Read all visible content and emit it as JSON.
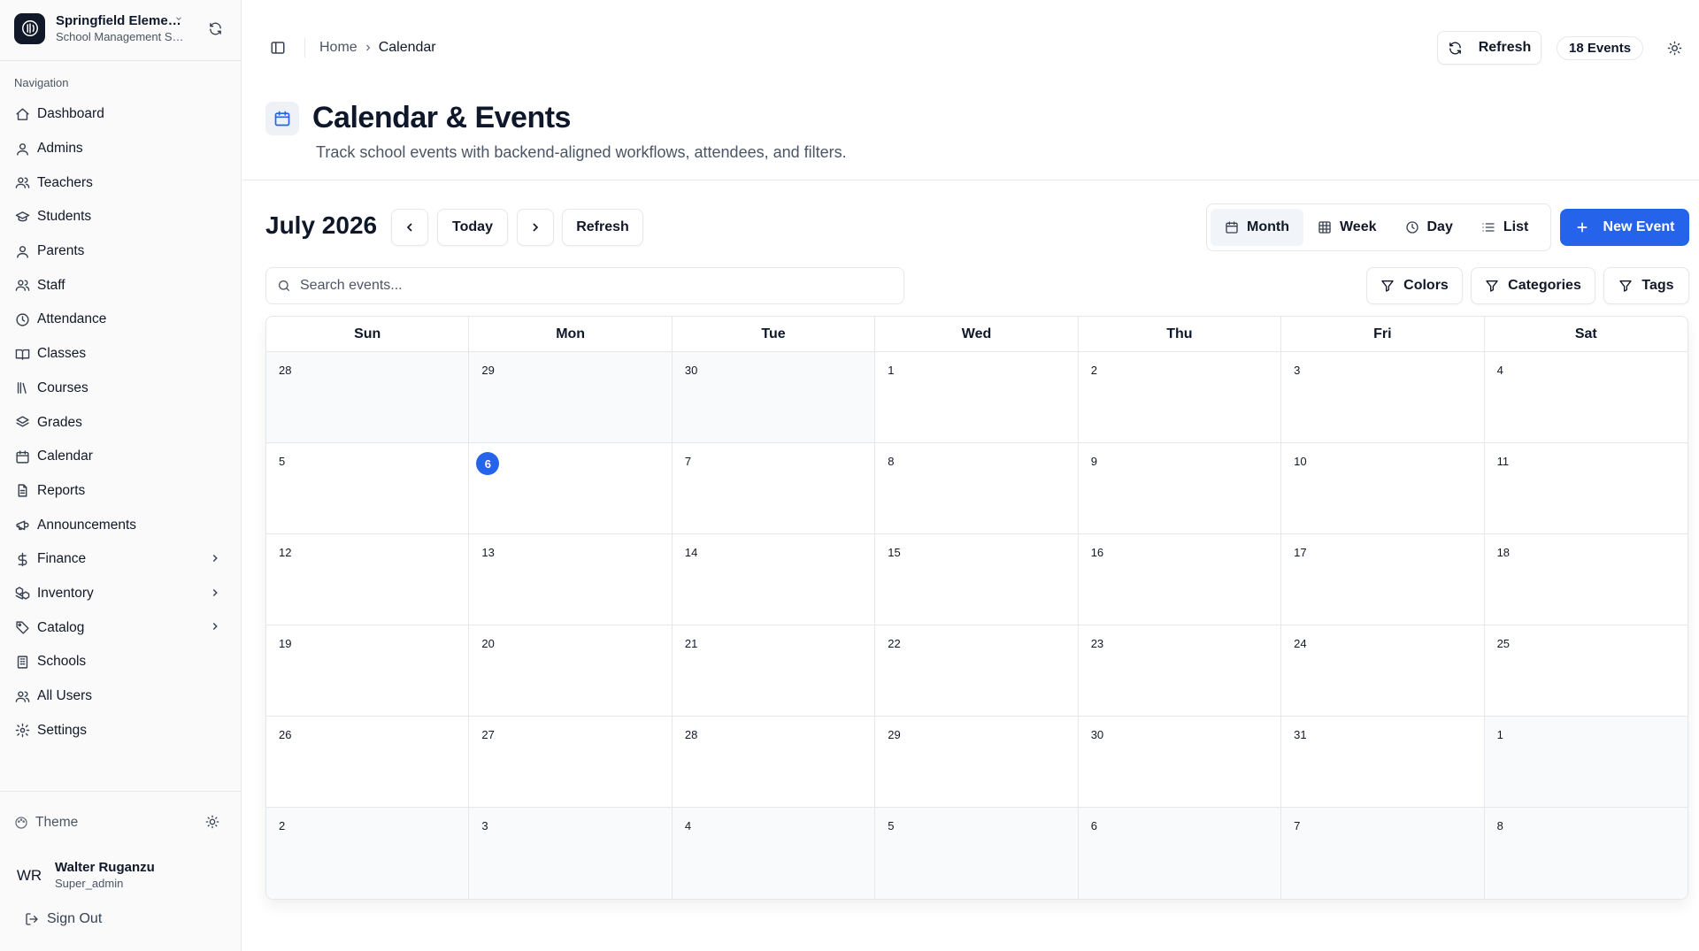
{
  "sidebar": {
    "org_name": "Springfield Elementary School",
    "org_subtitle": "School Management System",
    "nav_label": "Navigation",
    "items": [
      {
        "label": "Dashboard",
        "icon": "home-icon",
        "chevron": false
      },
      {
        "label": "Admins",
        "icon": "user-icon",
        "chevron": false
      },
      {
        "label": "Teachers",
        "icon": "users-icon",
        "chevron": false
      },
      {
        "label": "Students",
        "icon": "graduation-cap-icon",
        "chevron": false
      },
      {
        "label": "Parents",
        "icon": "user-icon",
        "chevron": false
      },
      {
        "label": "Staff",
        "icon": "users-icon",
        "chevron": false
      },
      {
        "label": "Attendance",
        "icon": "clock-icon",
        "chevron": false
      },
      {
        "label": "Classes",
        "icon": "book-open-icon",
        "chevron": false
      },
      {
        "label": "Courses",
        "icon": "library-icon",
        "chevron": false
      },
      {
        "label": "Grades",
        "icon": "layers-icon",
        "chevron": false
      },
      {
        "label": "Calendar",
        "icon": "calendar-icon",
        "chevron": false
      },
      {
        "label": "Reports",
        "icon": "file-text-icon",
        "chevron": false
      },
      {
        "label": "Announcements",
        "icon": "megaphone-icon",
        "chevron": false
      },
      {
        "label": "Finance",
        "icon": "dollar-icon",
        "chevron": true
      },
      {
        "label": "Inventory",
        "icon": "boxes-icon",
        "chevron": true
      },
      {
        "label": "Catalog",
        "icon": "tags-icon",
        "chevron": true
      },
      {
        "label": "Schools",
        "icon": "building-icon",
        "chevron": false
      },
      {
        "label": "All Users",
        "icon": "users-icon",
        "chevron": false
      },
      {
        "label": "Settings",
        "icon": "gear-icon",
        "chevron": false
      }
    ],
    "theme_label": "Theme",
    "user": {
      "initials": "WR",
      "name": "Walter Ruganzu",
      "role": "Super_admin"
    },
    "signout_label": "Sign Out"
  },
  "topbar": {
    "breadcrumb_home": "Home",
    "breadcrumb_current": "Calendar",
    "refresh_label": "Refresh",
    "events_badge": "18 Events"
  },
  "page": {
    "title": "Calendar & Events",
    "subtitle": "Track school events with backend-aligned workflows, attendees, and filters."
  },
  "toolbar": {
    "month_title": "July 2026",
    "today_label": "Today",
    "refresh_label": "Refresh",
    "views": [
      {
        "label": "Month",
        "icon": "calendar-icon",
        "active": true
      },
      {
        "label": "Week",
        "icon": "grid-icon",
        "active": false
      },
      {
        "label": "Day",
        "icon": "clock-icon",
        "active": false
      },
      {
        "label": "List",
        "icon": "list-icon",
        "active": false
      }
    ],
    "new_event_label": "New Event",
    "search_placeholder": "Search events...",
    "filters": {
      "colors": "Colors",
      "categories": "Categories",
      "tags": "Tags"
    }
  },
  "calendar": {
    "weekdays": [
      "Sun",
      "Mon",
      "Tue",
      "Wed",
      "Thu",
      "Fri",
      "Sat"
    ],
    "today": "6",
    "weeks": [
      [
        "28",
        "29",
        "30",
        "1",
        "2",
        "3",
        "4"
      ],
      [
        "5",
        "6",
        "7",
        "8",
        "9",
        "10",
        "11"
      ],
      [
        "12",
        "13",
        "14",
        "15",
        "16",
        "17",
        "18"
      ],
      [
        "19",
        "20",
        "21",
        "22",
        "23",
        "24",
        "25"
      ],
      [
        "26",
        "27",
        "28",
        "29",
        "30",
        "31",
        "1"
      ],
      [
        "2",
        "3",
        "4",
        "5",
        "6",
        "7",
        "8"
      ]
    ],
    "outside_month": [
      [
        0,
        0
      ],
      [
        0,
        1
      ],
      [
        0,
        2
      ],
      [
        4,
        6
      ],
      [
        5,
        0
      ],
      [
        5,
        1
      ],
      [
        5,
        2
      ],
      [
        5,
        3
      ],
      [
        5,
        4
      ],
      [
        5,
        5
      ],
      [
        5,
        6
      ]
    ]
  },
  "colors": {
    "accent": "#2563eb",
    "border": "#e5e7eb",
    "muted": "#4b5563"
  }
}
